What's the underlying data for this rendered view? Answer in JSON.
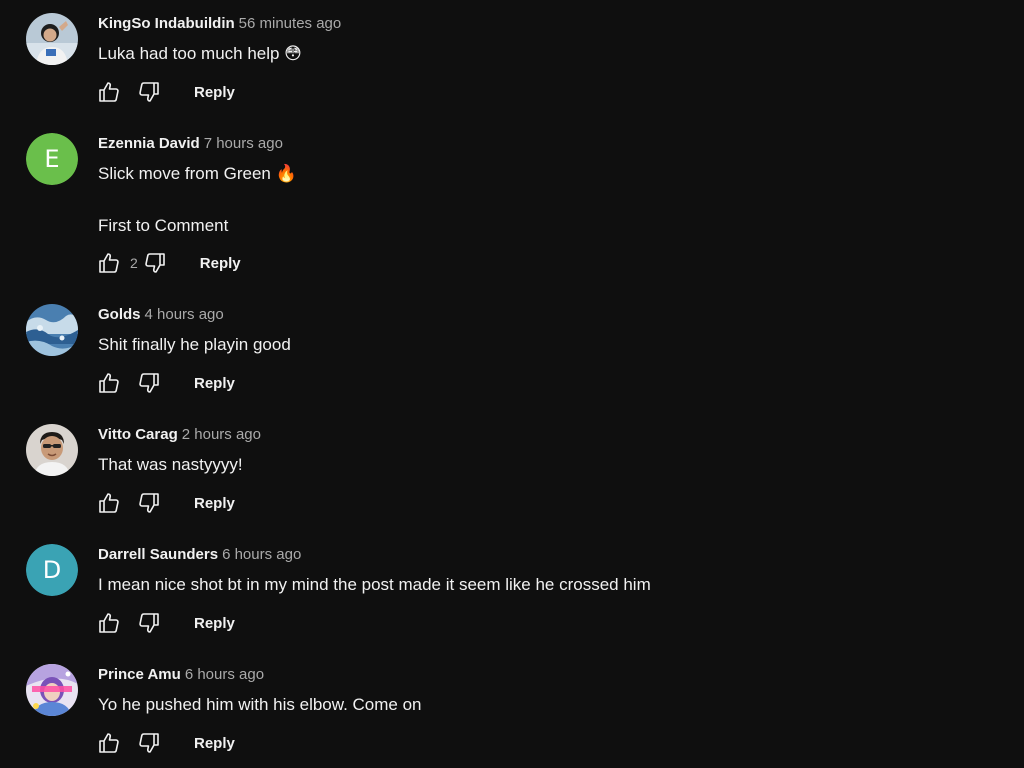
{
  "colors": {
    "background": "#0f0f0f",
    "text_primary": "#f1f1f1",
    "text_secondary": "#aaaaaa",
    "avatar_e": "#6abf4b",
    "avatar_d": "#3aa3b4"
  },
  "comments": [
    {
      "author": "KingSo Indabuildin",
      "time": "56 minutes ago",
      "text": "Luka had too much help 😳",
      "extra": "",
      "likes": "",
      "reply_label": "Reply",
      "avatar": {
        "type": "image",
        "icon": "user-photo-avatar"
      }
    },
    {
      "author": "Ezennia David",
      "time": "7 hours ago",
      "text": "Slick move from Green 🔥",
      "extra": "First to Comment",
      "likes": "2",
      "reply_label": "Reply",
      "avatar": {
        "type": "letter",
        "letter": "E",
        "color": "#6abf4b"
      }
    },
    {
      "author": "Golds",
      "time": "4 hours ago",
      "text": "Shit finally he playin good",
      "extra": "",
      "likes": "",
      "reply_label": "Reply",
      "avatar": {
        "type": "image",
        "icon": "landscape-photo-avatar"
      }
    },
    {
      "author": "Vitto Carag",
      "time": "2 hours ago",
      "text": "That was nastyyyy!",
      "extra": "",
      "likes": "",
      "reply_label": "Reply",
      "avatar": {
        "type": "image",
        "icon": "face-photo-avatar"
      }
    },
    {
      "author": "Darrell Saunders",
      "time": "6 hours ago",
      "text": "I mean nice shot bt in my mind the post made it seem like he crossed him",
      "extra": "",
      "likes": "",
      "reply_label": "Reply",
      "avatar": {
        "type": "letter",
        "letter": "D",
        "color": "#3aa3b4"
      }
    },
    {
      "author": "Prince Amu",
      "time": "6 hours ago",
      "text": "Yo he pushed him with his elbow. Come on",
      "extra": "",
      "likes": "",
      "reply_label": "Reply",
      "avatar": {
        "type": "image",
        "icon": "anime-photo-avatar"
      }
    }
  ]
}
